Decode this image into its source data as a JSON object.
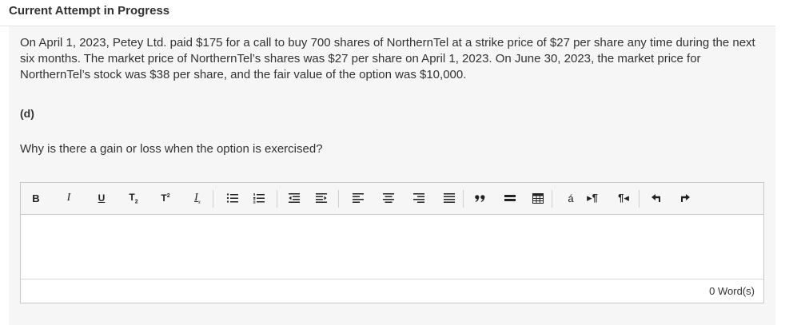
{
  "header": {
    "title": "Current Attempt in Progress"
  },
  "question": {
    "text": "On April 1, 2023, Petey Ltd. paid $175 for a call to buy 700 shares of NorthernTel at a strike price of $27 per share any time during the next six months. The market price of NorthernTel’s shares was $27 per share on April 1, 2023. On June 30, 2023, the market price for NorthernTel’s stock was $38 per share, and the fair value of the option was $10,000."
  },
  "part": {
    "label": "(d)"
  },
  "prompt": {
    "text": "Why is there a gain or loss when the option is exercised?"
  },
  "editor": {
    "toolbar": {
      "bold": "B",
      "italic": "I",
      "underline": "U",
      "subscript": "T",
      "subscript_mark": "2",
      "superscript": "T",
      "superscript_mark": "2",
      "clear_format": "I",
      "clear_format_mark": "x",
      "special_char": "á",
      "ltr_mark": "▸¶",
      "rtl_mark": "¶◂"
    },
    "value": "",
    "word_count": "0 Word(s)"
  },
  "icons": {
    "bullet_list": "bulleted-list-icon",
    "numbered_list": "numbered-list-icon",
    "outdent": "outdent-icon",
    "indent": "indent-icon",
    "align_left": "align-left-icon",
    "align_center": "align-center-icon",
    "align_right": "align-right-icon",
    "justify": "justify-icon",
    "blockquote": "blockquote-icon",
    "horizontal_rule": "horizontal-line-icon",
    "table": "table-icon",
    "undo": "undo-icon",
    "redo": "redo-icon"
  }
}
